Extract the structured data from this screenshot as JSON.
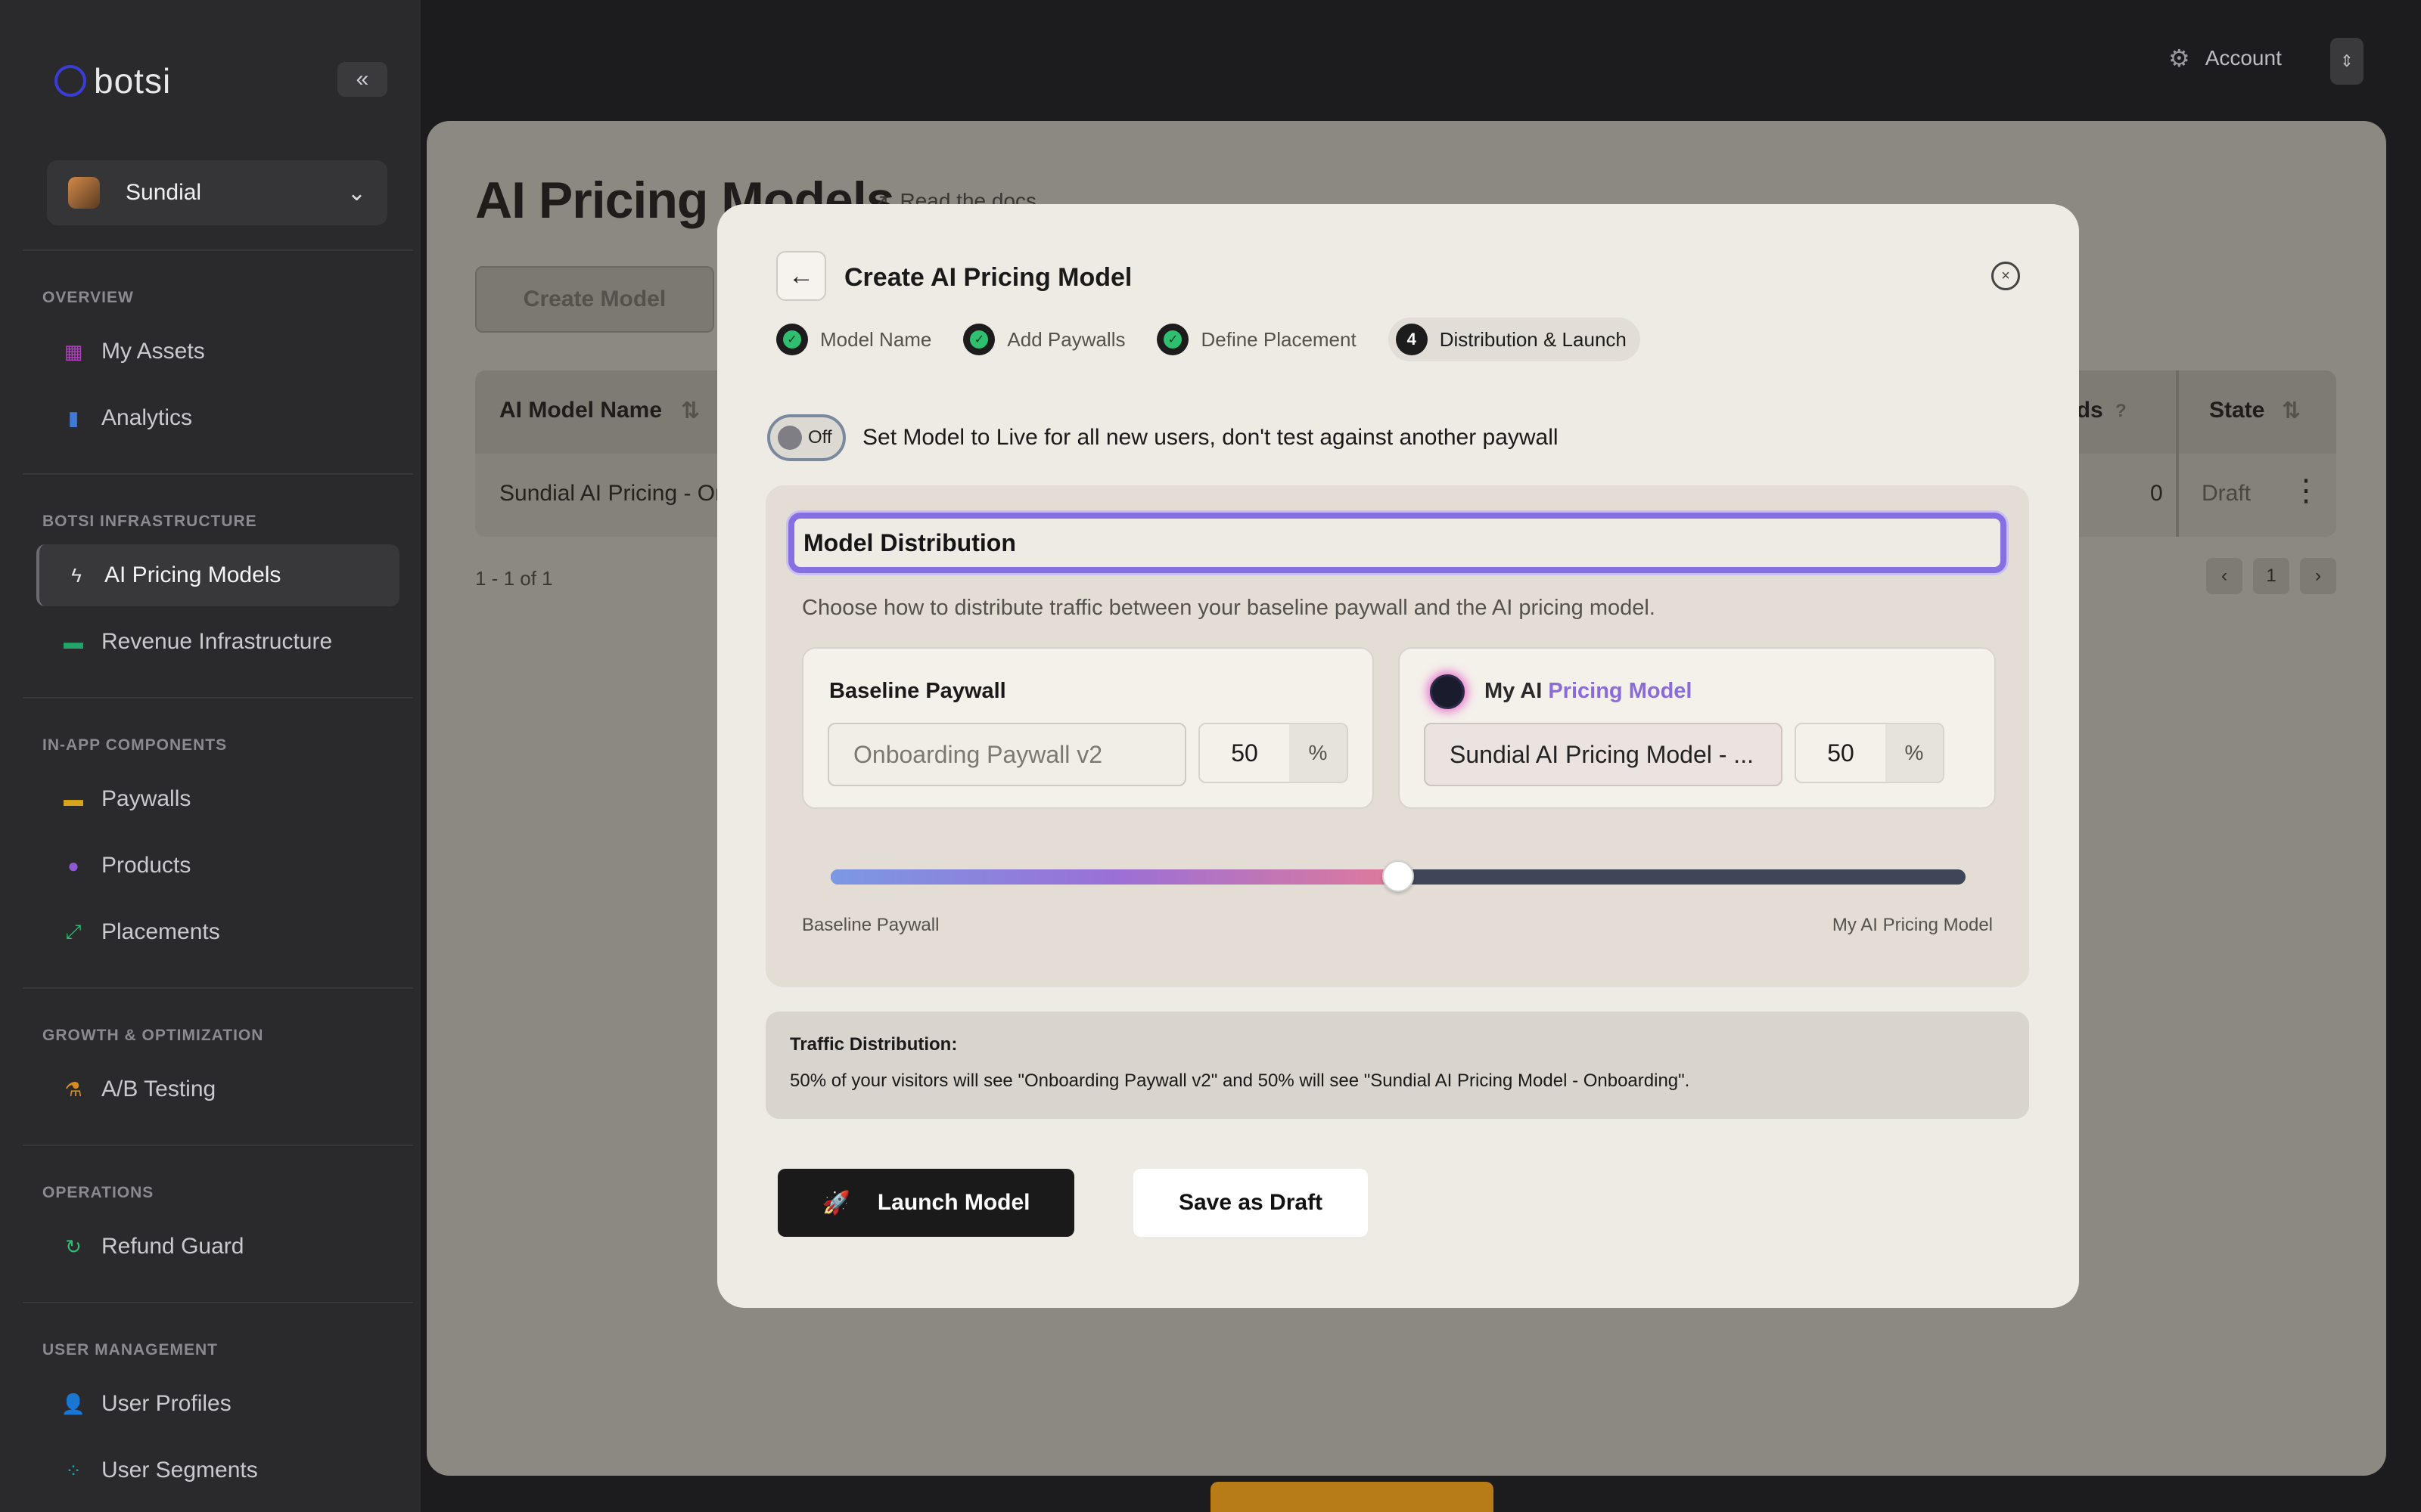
{
  "sidebar": {
    "logo": "botsi",
    "collapse_icon": "«",
    "app_name": "Sundial",
    "sections": [
      {
        "title": "OVERVIEW",
        "items": [
          {
            "label": "My Assets",
            "icon": "assets-icon",
            "color": "#b33fc4"
          },
          {
            "label": "Analytics",
            "icon": "bar-chart-icon",
            "color": "#3f7bd6"
          }
        ]
      },
      {
        "title": "BOTSI INFRASTRUCTURE",
        "items": [
          {
            "label": "AI Pricing Models",
            "icon": "bolt-icon",
            "color": "#e4e4e4",
            "active": true
          },
          {
            "label": "Revenue Infrastructure",
            "icon": "card-icon",
            "color": "#22a36a"
          }
        ]
      },
      {
        "title": "IN-APP COMPONENTS",
        "items": [
          {
            "label": "Paywalls",
            "icon": "wallet-icon",
            "color": "#d9a31b"
          },
          {
            "label": "Products",
            "icon": "tag-icon",
            "color": "#9158d6"
          },
          {
            "label": "Placements",
            "icon": "expand-icon",
            "color": "#2fbf71"
          }
        ]
      },
      {
        "title": "GROWTH & OPTIMIZATION",
        "items": [
          {
            "label": "A/B Testing",
            "icon": "flask-icon",
            "color": "#d98b1b"
          }
        ]
      },
      {
        "title": "OPERATIONS",
        "items": [
          {
            "label": "Refund Guard",
            "icon": "refresh-icon",
            "color": "#2fbf71"
          }
        ]
      },
      {
        "title": "USER MANAGEMENT",
        "items": [
          {
            "label": "User Profiles",
            "icon": "user-icon",
            "color": "#7a6ae0"
          },
          {
            "label": "User Segments",
            "icon": "segments-icon",
            "color": "#22a3a3"
          }
        ]
      }
    ]
  },
  "topbar": {
    "account_label": "Account",
    "account_icon": "gear-icon"
  },
  "main": {
    "title": "AI Pricing Models",
    "docs_label": "Read the docs",
    "create_button": "Create Model",
    "table": {
      "headers": {
        "name": "AI Model Name",
        "refunds": "unds",
        "state": "State"
      },
      "row": {
        "name": "Sundial AI Pricing - Or",
        "refunds": "0",
        "state": "Draft"
      }
    },
    "range": "1 - 1 of 1",
    "page": "1"
  },
  "modal": {
    "title": "Create AI Pricing Model",
    "steps": [
      {
        "label": "Model Name",
        "done": true
      },
      {
        "label": "Add Paywalls",
        "done": true
      },
      {
        "label": "Define Placement",
        "done": true
      },
      {
        "label": "Distribution & Launch",
        "number": "4",
        "current": true
      }
    ],
    "toggle": {
      "state": "Off",
      "description": "Set Model to Live for all new users, don't test against another paywall"
    },
    "distribution": {
      "title": "Model Distribution",
      "description": "Choose how to distribute traffic between your baseline paywall and the AI pricing model.",
      "baseline": {
        "title": "Baseline Paywall",
        "value": "Onboarding Paywall v2",
        "percent": "50",
        "unit": "%"
      },
      "ai": {
        "title_a": "My AI",
        "title_b": " Pricing Model",
        "value": "Sundial AI Pricing Model - ...",
        "percent": "50",
        "unit": "%"
      },
      "slider": {
        "value": 0.5,
        "left_label": "Baseline Paywall",
        "right_label": "My AI Pricing Model"
      }
    },
    "traffic": {
      "title": "Traffic Distribution:",
      "text": "50% of your visitors will see \"Onboarding Paywall v2\" and 50% will see \"Sundial AI Pricing Model - Onboarding\"."
    },
    "launch_button": "Launch Model",
    "draft_button": "Save as Draft"
  }
}
